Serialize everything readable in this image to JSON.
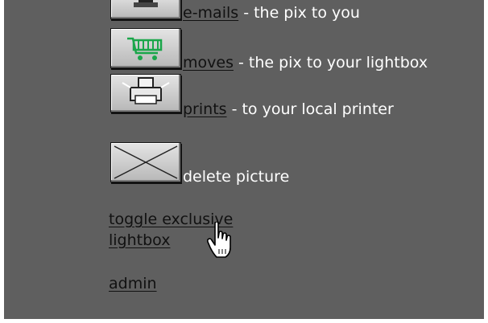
{
  "actions": [
    {
      "icon": "mail-icon",
      "link": "e-mails",
      "desc": " - the pix to you"
    },
    {
      "icon": "shopping-cart-icon",
      "link": "moves",
      "desc": " - the pix to your lightbox"
    },
    {
      "icon": "printer-icon",
      "link": "prints",
      "desc": " - to your local printer"
    },
    {
      "icon": "envelope-x-icon",
      "link": "",
      "desc": "delete picture"
    }
  ],
  "links": {
    "toggle_line1": "toggle exclusive",
    "toggle_line2": "lightbox",
    "admin": "admin"
  },
  "colors": {
    "background": "#5f5f5f",
    "text": "#ffffff",
    "link": "#111111",
    "cart_green": "#1aa64a"
  },
  "cursor_icon": "hand-pointer-icon"
}
